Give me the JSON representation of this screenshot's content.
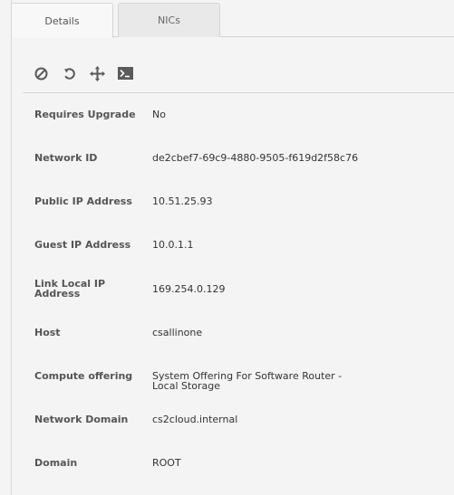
{
  "tabs": [
    {
      "label": "Details"
    },
    {
      "label": "NICs"
    }
  ],
  "toolbar": {
    "icons": [
      "stop-icon",
      "reboot-icon",
      "migrate-icon",
      "console-icon"
    ]
  },
  "details": [
    {
      "label": "Requires Upgrade",
      "value": "No"
    },
    {
      "label": "Network ID",
      "value": "de2cbef7-69c9-4880-9505-f619d2f58c76"
    },
    {
      "label": "Public IP Address",
      "value": "10.51.25.93"
    },
    {
      "label": "Guest IP Address",
      "value": "10.0.1.1"
    },
    {
      "label": "Link Local IP Address",
      "value": "169.254.0.129"
    },
    {
      "label": "Host",
      "value": "csallinone"
    },
    {
      "label": "Compute offering",
      "value": "System Offering For Software Router - Local Storage"
    },
    {
      "label": "Network Domain",
      "value": "cs2cloud.internal"
    },
    {
      "label": "Domain",
      "value": "ROOT"
    }
  ]
}
